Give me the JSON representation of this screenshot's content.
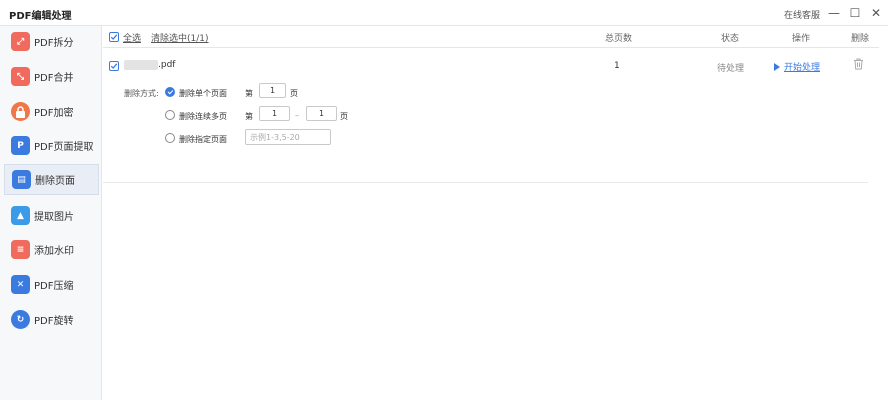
{
  "app": {
    "title": "PDF编辑处理",
    "online_service": "在线客服",
    "minimize_glyph": "—",
    "maximize_glyph": "☐",
    "close_glyph": "✕"
  },
  "sidebar": {
    "items": [
      {
        "label": "PDF拆分",
        "icon": "split-icon",
        "color": "#f06a5d",
        "glyph": "⤢"
      },
      {
        "label": "PDF合并",
        "icon": "merge-icon",
        "color": "#f06a5d",
        "glyph": "⤡"
      },
      {
        "label": "PDF加密",
        "icon": "lock-icon",
        "color": "#f0774a",
        "glyph": "🔒"
      },
      {
        "label": "PDF页面提取",
        "icon": "extract-page-icon",
        "color": "#3b7be0",
        "glyph": "P"
      },
      {
        "label": "删除页面",
        "icon": "delete-page-icon",
        "color": "#3b7be0",
        "glyph": "▤"
      },
      {
        "label": "提取图片",
        "icon": "image-icon",
        "color": "#3b9be8",
        "glyph": "▲"
      },
      {
        "label": "添加水印",
        "icon": "watermark-icon",
        "color": "#f06a5d",
        "glyph": "≡"
      },
      {
        "label": "PDF压缩",
        "icon": "compress-icon",
        "color": "#3b7be0",
        "glyph": "✕"
      },
      {
        "label": "PDF旋转",
        "icon": "rotate-icon",
        "color": "#3b7be0",
        "glyph": "↻"
      }
    ],
    "active_index": 4
  },
  "header": {
    "select_all": "全选",
    "clear_selected": "清除选中(1/1)",
    "col_total_pages": "总页数",
    "col_status": "状态",
    "col_action": "操作",
    "col_delete": "删除"
  },
  "file": {
    "name_suffix": ".pdf",
    "total_pages": "1",
    "status": "待处理",
    "start_action": "开始处理",
    "delete_mode_label": "删除方式:",
    "options": {
      "single": "删除单个页面",
      "range": "删除连续多页",
      "specified": "删除指定页面"
    },
    "prefix_word": "第",
    "suffix_word": "页",
    "range_sep": "–",
    "single_value": "1",
    "range_from": "1",
    "range_to": "1",
    "specified_placeholder": "示例1-3,5-20"
  },
  "colors": {
    "accent": "#3b7be0",
    "sidebar_bg": "#f7f8fa",
    "active_bg": "#e9eef6"
  }
}
